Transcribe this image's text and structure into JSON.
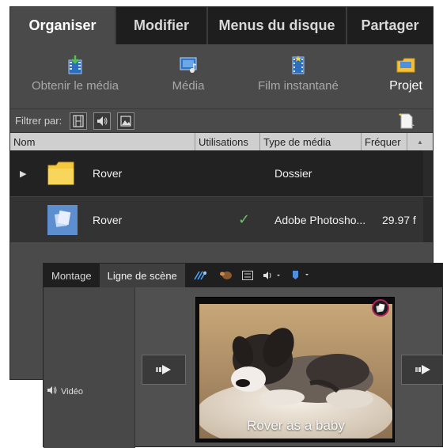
{
  "organiser": {
    "tabs": [
      {
        "label": "Organiser"
      },
      {
        "label": "Modifier"
      },
      {
        "label": "Menus du disque"
      },
      {
        "label": "Partager"
      }
    ],
    "tools": {
      "obtenir": "Obtenir le média",
      "media": "Média",
      "film": "Film instantané",
      "projet": "Projet"
    },
    "filter_label": "Filtrer par:",
    "columns": {
      "nom": "Nom",
      "utilisations": "Utilisations",
      "type": "Type de média",
      "frequence": "Fréquer"
    },
    "rows": [
      {
        "name": "Rover",
        "type": "Dossier"
      },
      {
        "name": "Rover",
        "used": "✓",
        "type": "Adobe Photosho...",
        "frequency": "29.97 f"
      }
    ]
  },
  "timeline": {
    "tabs": [
      {
        "label": "Montage"
      },
      {
        "label": "Ligne de scène"
      }
    ],
    "video_label": "Vidéo",
    "clip_caption": "Rover as a baby"
  },
  "colors": {
    "panel_bg": "#4a4a4a",
    "tab_active": "#4a4a4a",
    "tab_inactive": "#1e1e1e",
    "badge_ring": "#b0245e",
    "check": "#6ec26e"
  }
}
